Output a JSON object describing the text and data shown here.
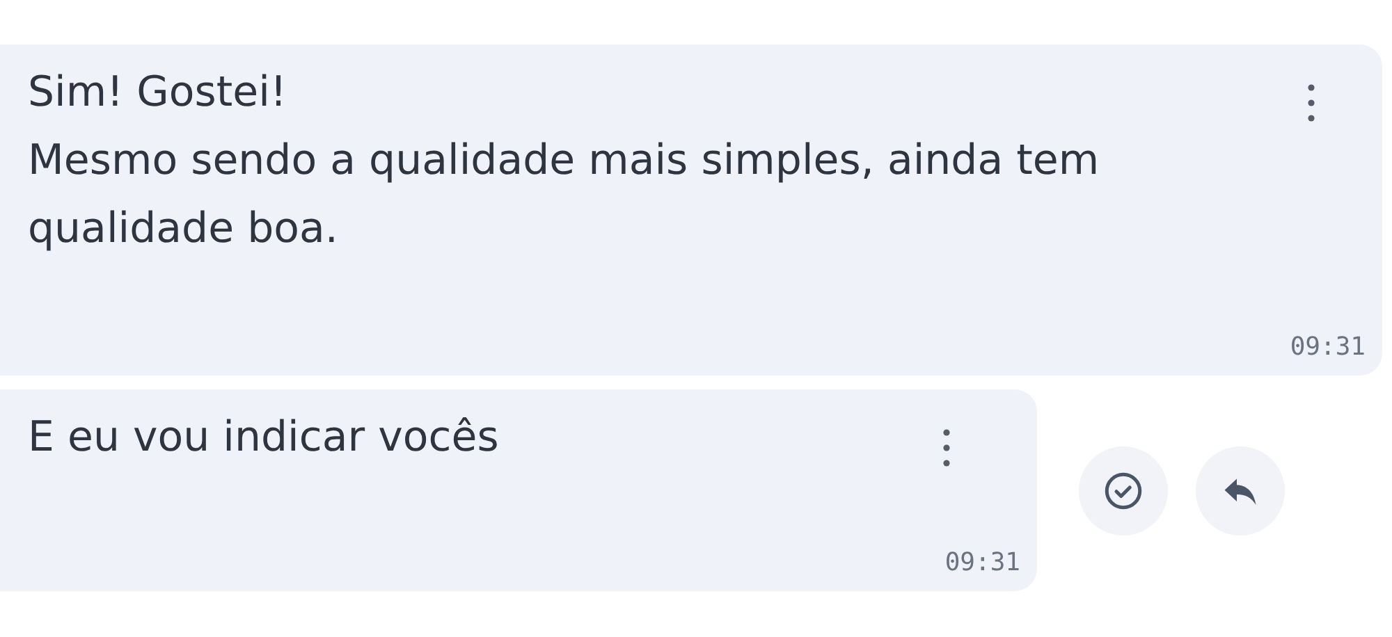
{
  "messages": [
    {
      "text": "Sim! Gostei!\nMesmo sendo a qualidade mais simples, ainda tem\nqualidade boa.",
      "time": "09:31"
    },
    {
      "text": "E eu vou indicar vocês",
      "time": "09:31",
      "actions": [
        {
          "kind": "check"
        },
        {
          "kind": "reply"
        }
      ]
    }
  ]
}
